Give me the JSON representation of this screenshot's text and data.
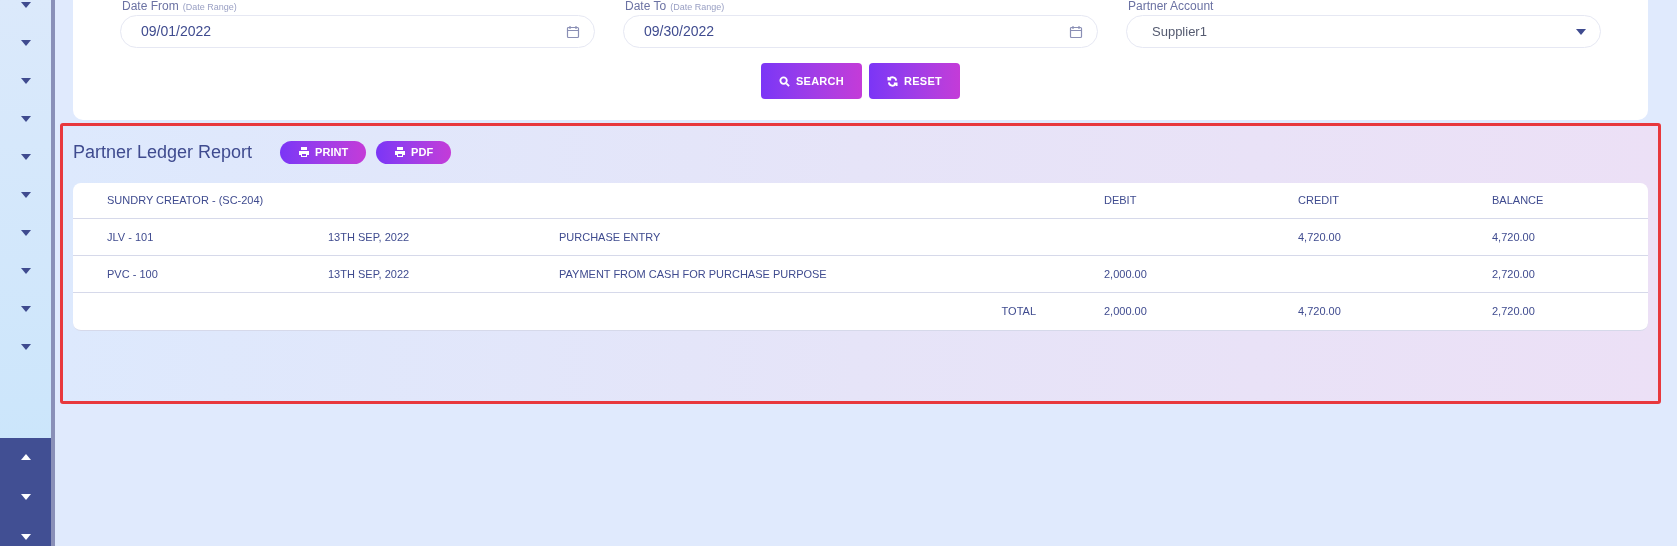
{
  "sidebar": {
    "items": [
      {
        "expanded": false
      },
      {
        "expanded": false
      },
      {
        "expanded": false
      },
      {
        "expanded": false
      },
      {
        "expanded": false
      },
      {
        "expanded": false
      },
      {
        "expanded": false
      },
      {
        "expanded": false
      },
      {
        "expanded": false
      },
      {
        "expanded": false
      }
    ],
    "footer_items": [
      {
        "expanded": true
      },
      {
        "expanded": false
      },
      {
        "expanded": false
      }
    ]
  },
  "filters": [
    {
      "kind": "date",
      "label": "Date From",
      "hint": "(Date Range)",
      "value": "09/01/2022"
    },
    {
      "kind": "date",
      "label": "Date To",
      "hint": "(Date Range)",
      "value": "09/30/2022"
    },
    {
      "kind": "select",
      "label": "Partner Account",
      "value": "Supplier1"
    }
  ],
  "actions": [
    {
      "kind": "search",
      "label": "SEARCH"
    },
    {
      "kind": "reset",
      "label": "RESET"
    }
  ],
  "report": {
    "title": "Partner Ledger Report",
    "buttons": [
      {
        "label": "PRINT"
      },
      {
        "label": "PDF"
      }
    ],
    "columns": [
      "SUNDRY CREATOR - (SC-204)",
      "",
      "",
      "",
      "DEBIT",
      "CREDIT",
      "BALANCE"
    ],
    "rows": [
      [
        "JLV - 101",
        "13TH SEP, 2022",
        "PURCHASE ENTRY",
        "",
        "",
        "4,720.00",
        "4,720.00"
      ],
      [
        "PVC - 100",
        "13TH SEP, 2022",
        "PAYMENT FROM CASH FOR PURCHASE PURPOSE",
        "",
        "2,000.00",
        "",
        "2,720.00"
      ],
      [
        "",
        "",
        "",
        "TOTAL",
        "2,000.00",
        "4,720.00",
        "2,720.00"
      ]
    ]
  }
}
